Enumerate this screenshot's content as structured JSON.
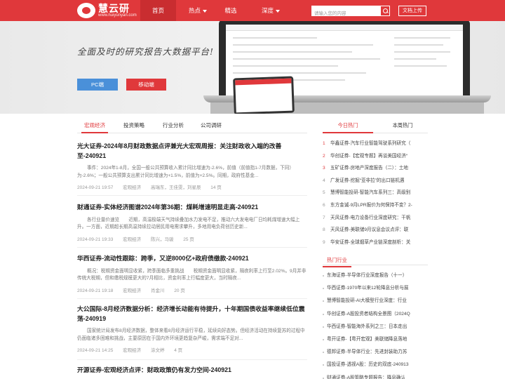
{
  "header": {
    "logo_title": "慧云研",
    "logo_url": "www.huiyunyan.com",
    "nav": [
      {
        "label": "首页",
        "active": true,
        "dropdown": false
      },
      {
        "label": "热点",
        "active": false,
        "dropdown": true
      },
      {
        "label": "精选",
        "active": false,
        "dropdown": false
      },
      {
        "label": "深度",
        "active": false,
        "dropdown": true
      }
    ],
    "search_placeholder": "请输入您的内容",
    "upload_label": "文档上传"
  },
  "banner": {
    "slogan": "全面及时的研究报告大数据平台!",
    "pc_button": "PC端",
    "mobile_button": "移动端"
  },
  "tabs": [
    {
      "label": "宏观经济",
      "active": true
    },
    {
      "label": "投资策略",
      "active": false
    },
    {
      "label": "行业分析",
      "active": false
    },
    {
      "label": "公司调研",
      "active": false
    }
  ],
  "articles": [
    {
      "title": "光大证券-2024年8月财政数据点评兼光大宏观周报：关注财政收入端的改善至-240921",
      "summary": "事件：2024年1-8月，全国一般公共预算收入累计同比增速为-2.6%，前值（前值指1-7月数据，下同）为-2.6%；一般公共预算支出累计同比增速为+1.5%，前值为+2.5%。同期，政府性基金...",
      "date": "2024-09-21 19:57",
      "category": "宏观经济",
      "authors": "高瑞东，王佳雯，刘星辰",
      "pages": "14 页"
    },
    {
      "title": "财通证券-实体经济图谱2024年第36期：煤耗增速明显走高-240921",
      "summary": "各行业量价速览　　近期，高温极端天气持续叠加水力发电不足，推动六大发电电厂日均耗煤增速大幅上升。一方面，近期超长期高温持续拉动居民用电需求攀升，多地用电负荷创历史新...",
      "date": "2024-09-21 19:33",
      "category": "宏观经济",
      "authors": "陈兴，马骏",
      "pages": "25 页"
    },
    {
      "title": "华西证券-流动性跟踪：跨季，又逆8000亿+政府债缴款-240921",
      "summary": "概况：税期资金面明显收紧，跨季面临多重挑战　　税期资金面明显收紧，隔夜利率上行至2.02%。9月并非传统大税期，但和缴税规模更大的7月相比，资金利率上行幅度更大，当时隔夜...",
      "date": "2024-09-21 19:18",
      "category": "宏观经济",
      "authors": "肖金川",
      "pages": "20 页"
    },
    {
      "title": "大公国际-8月经济数据分析：经济增长动能有待提升，十年期国债收益率继续低位震荡-240919",
      "summary": "国家统计局发布8月经济数据，整体来看8月经济运行平稳，延续向好态势。但经济活动在持续复苏的过程中仍面临诸多困难和挑战，主要原因在于国内外环境更趋复杂严峻，需求端不足对...",
      "date": "2024-09-21 14:25",
      "category": "宏观经济",
      "authors": "涂文婷",
      "pages": "4 页"
    },
    {
      "title": "开源证券-宏观经济点评：财政政策仍有发力空间-240921",
      "summary": "",
      "date": "",
      "category": "",
      "authors": "",
      "pages": ""
    }
  ],
  "right_tabs": [
    {
      "label": "今日热门",
      "active": true
    },
    {
      "label": "本周热门",
      "active": false
    }
  ],
  "hot_today": [
    {
      "num": "1",
      "text": "华鑫证券-汽车行业智能驾驶系列研究（"
    },
    {
      "num": "2",
      "text": "华创证券-【宏观专题】再谈美国经济“"
    },
    {
      "num": "3",
      "text": "五矿证券-房地产深度报告（二）：土地"
    },
    {
      "num": "4",
      "text": "广发证券-挖掘“亚非拉”的出口链机遇"
    },
    {
      "num": "5",
      "text": "慧博智能投研-智能汽车系列三：高级别"
    },
    {
      "num": "6",
      "text": "东方金诚-9月LPR报价为何保持不变？2-"
    },
    {
      "num": "7",
      "text": "天风证券-电力设备行业深度研究：干帆"
    },
    {
      "num": "8",
      "text": "天风证券-美联储9月议息会议点评：联"
    },
    {
      "num": "9",
      "text": "华安证券-全球烟草产业链深度剖析：关"
    }
  ],
  "hot_industry_title": "热门行业",
  "hot_industry": [
    "东海证券-半导体行业深度报告（十一）",
    "华西证券-1970年以来12轮降息分析与展",
    "慧博智能投研-AI大模型行业深度：行业",
    "华创证券-A股投资者结构全景图（2024Q",
    "华西证券-智能海外系列之三：日本走出",
    "粤开证券-【粤开宏观】美联储降息落地",
    "德邦证券-半导体行业：先进封装助力苏",
    "国投证券-透视A股：历史的双底-240913",
    "财通证券-A股策略专题报告：降息确认"
  ]
}
